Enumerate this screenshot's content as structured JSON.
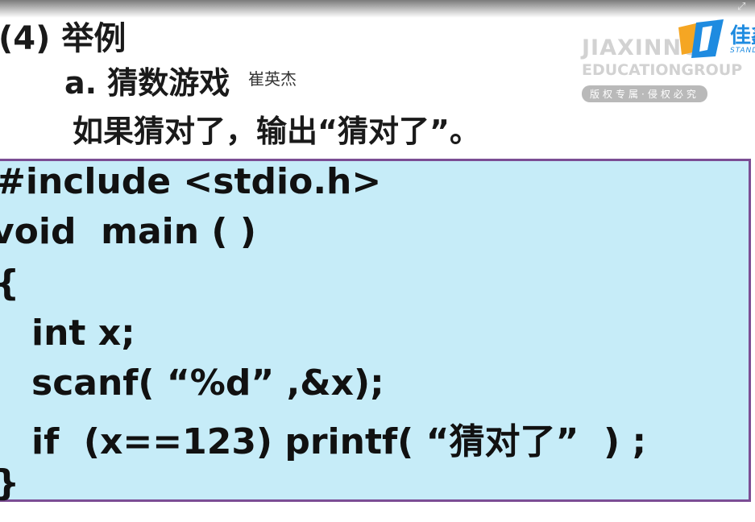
{
  "slide": {
    "heading": "(4) 举例",
    "subheading": "a. 猜数游戏",
    "description": "如果猜对了，输出“猜对了”。",
    "watermark_name": "崔英杰"
  },
  "brand": {
    "line1": "JIAXINNO",
    "line2": "EDUCATIONGROUP",
    "tagline": "版权专属·侵权必究",
    "logo_text": "佳鑫",
    "logo_sub": "STANDS",
    "colors": {
      "logo_blue": "#1e8be0",
      "logo_orange": "#f5a623"
    }
  },
  "code": {
    "lines": [
      "#include <stdio.h>",
      "void  main ( )",
      "{",
      "int x;",
      "scanf( “%d” ,&x);",
      "if  (x==123) printf( “猜对了”  ) ;",
      "}"
    ],
    "background": "#c6ecf8",
    "border": "#7b4d94"
  },
  "controls": {
    "fullscreen_icon": "fullscreen-icon"
  }
}
